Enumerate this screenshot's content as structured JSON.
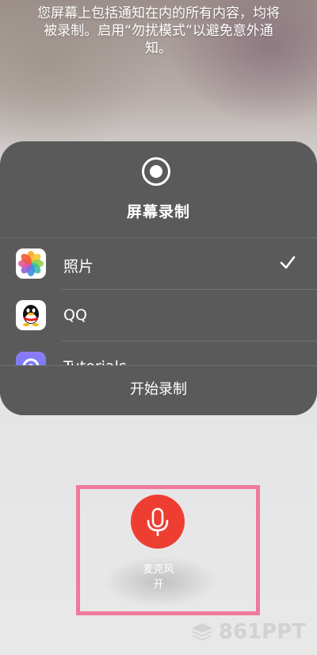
{
  "notice": {
    "line1": "您屏幕上包括通知在内的所有内容，均将",
    "line2": "被录制。启用“勿扰模式”以避免意外通",
    "line3": "知。"
  },
  "panel": {
    "title": "屏幕录制",
    "apps": [
      {
        "label": "照片",
        "icon": "photos-icon",
        "selected": true
      },
      {
        "label": "QQ",
        "icon": "qq-icon",
        "selected": false
      },
      {
        "label": "Tutorials",
        "icon": "tutorials-icon",
        "selected": false
      }
    ],
    "start_label": "开始录制"
  },
  "microphone": {
    "label_line1": "麦克风",
    "label_line2": "开",
    "button_color": "#ee3e32"
  },
  "watermark": {
    "text": "861PPT"
  },
  "colors": {
    "highlight": "#ef7a9c",
    "panel": "#5b5a5a"
  }
}
